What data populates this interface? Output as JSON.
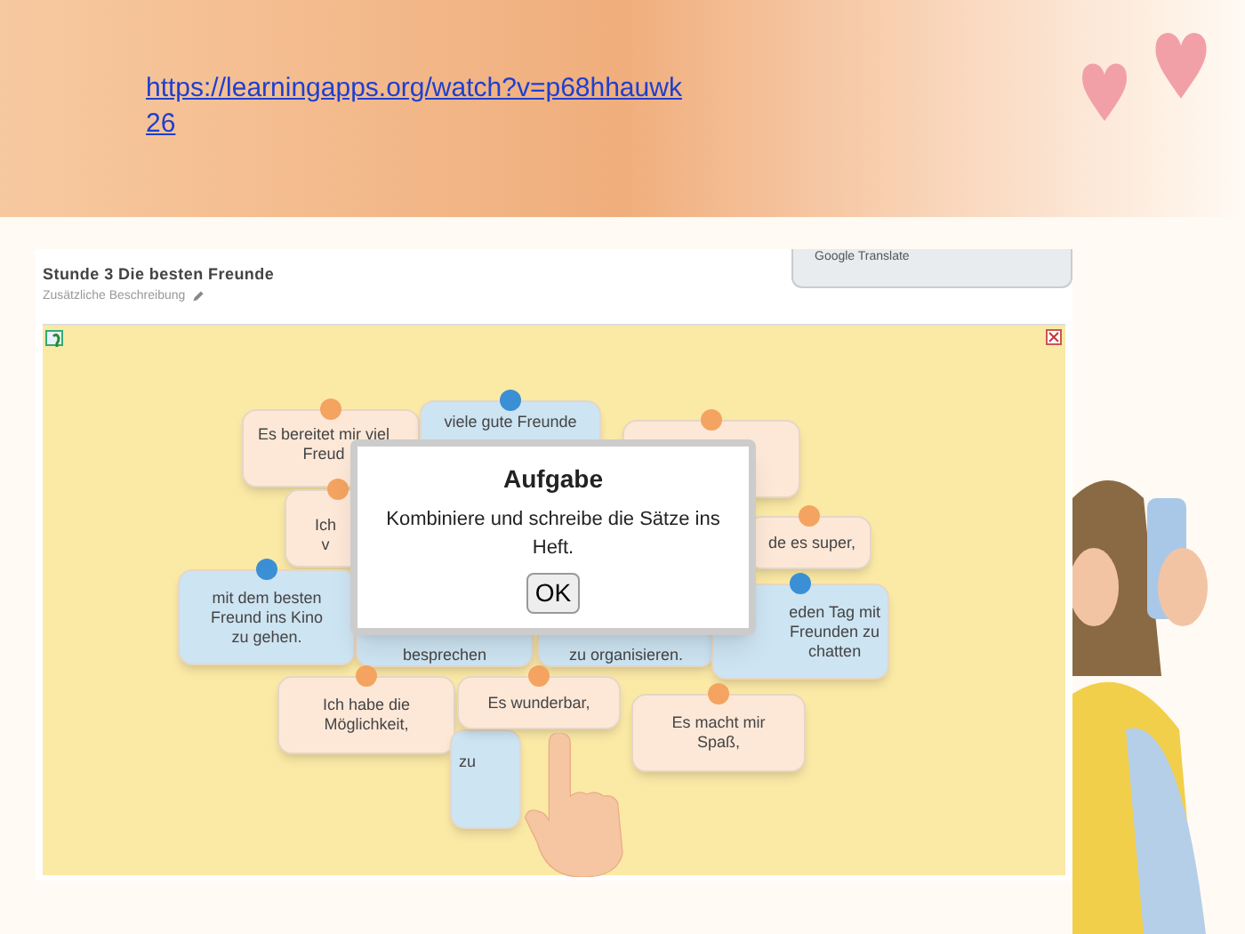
{
  "slide": {
    "link": "https://learningapps.org/watch?v=p68hhauwk\n26"
  },
  "app": {
    "title": "Stunde 3 Die besten Freunde",
    "description": "Zusätzliche Beschreibung",
    "translate_label": "Google Translate",
    "cards": [
      {
        "kind": "beginning",
        "color": "#f4a460",
        "text": "Es bereitet mir viel\nFreud"
      },
      {
        "kind": "ending",
        "color": "#3b8fd4",
        "text": "viele gute Freunde"
      },
      {
        "kind": "beginning",
        "color": "#f4a460"
      },
      {
        "kind": "beginning",
        "color": "#f4a460",
        "text": "Ich\nv"
      },
      {
        "kind": "beginning",
        "color": "#f4a460",
        "text": "de es super,"
      },
      {
        "kind": "ending",
        "color": "#3b8fd4",
        "text": "mit dem besten\nFreund ins Kino\nzu gehen."
      },
      {
        "kind": "ending",
        "text": "besprechen"
      },
      {
        "kind": "ending",
        "text": "zu organisieren."
      },
      {
        "kind": "ending",
        "color": "#3b8fd4",
        "text": "eden Tag mit\nFreunden zu\nchatten"
      },
      {
        "kind": "beginning",
        "color": "#f4a460",
        "text": "Ich habe die\nMöglichkeit,"
      },
      {
        "kind": "ending",
        "text": "zu"
      },
      {
        "kind": "beginning",
        "color": "#f4a460",
        "text": "Es   wunderbar,"
      },
      {
        "kind": "beginning",
        "color": "#f4a460",
        "text": "Es macht mir\nSpaß,"
      }
    ],
    "dialog": {
      "title": "Aufgabe",
      "message": "Kombiniere und schreibe die Sätze ins Heft.",
      "button": "OK"
    }
  }
}
